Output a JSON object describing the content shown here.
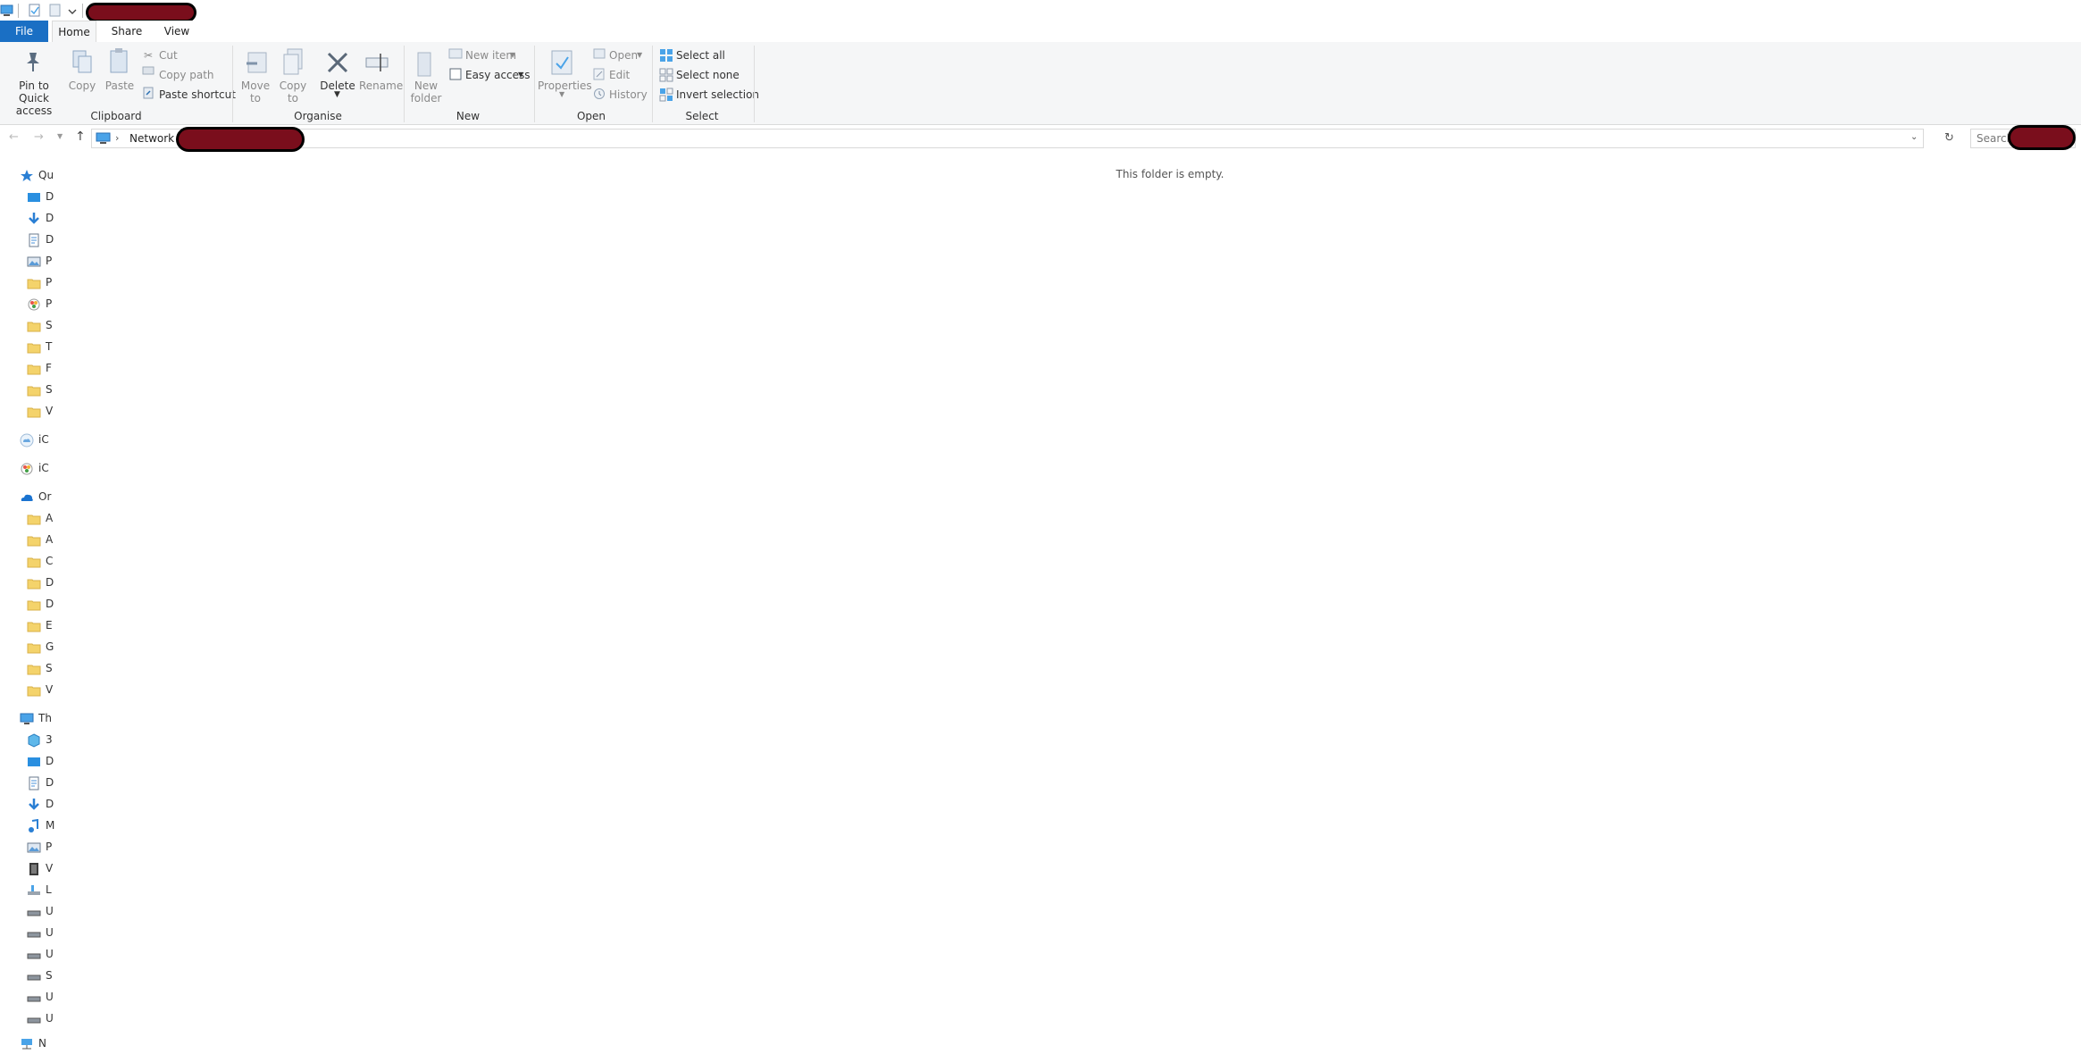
{
  "tabs": {
    "file": "File",
    "home": "Home",
    "share": "Share",
    "view": "View"
  },
  "ribbon": {
    "clipboard": {
      "pin": "Pin to Quick access",
      "copy": "Copy",
      "paste": "Paste",
      "cut": "Cut",
      "copy_path": "Copy path",
      "paste_shortcut": "Paste shortcut",
      "group": "Clipboard"
    },
    "organise": {
      "move_to": "Move to",
      "copy_to": "Copy to",
      "delete": "Delete",
      "rename": "Rename",
      "group": "Organise"
    },
    "new": {
      "new_folder": "New folder",
      "new_item": "New item",
      "easy_access": "Easy access",
      "group": "New"
    },
    "open": {
      "properties": "Properties",
      "open": "Open",
      "edit": "Edit",
      "history": "History",
      "group": "Open"
    },
    "select": {
      "select_all": "Select all",
      "select_none": "Select none",
      "invert_selection": "Invert selection",
      "group": "Select"
    }
  },
  "address": {
    "root": "Network",
    "search_placeholder": "Search"
  },
  "nav": {
    "items": [
      {
        "label": "Qu",
        "icon": "star-icon"
      },
      {
        "label": "D",
        "icon": "desktop-icon"
      },
      {
        "label": "D",
        "icon": "download-icon"
      },
      {
        "label": "D",
        "icon": "document-icon"
      },
      {
        "label": "P",
        "icon": "pictures-icon"
      },
      {
        "label": "P",
        "icon": "folder-icon"
      },
      {
        "label": "P",
        "icon": "photos-icon"
      },
      {
        "label": "S",
        "icon": "folder-icon"
      },
      {
        "label": "T",
        "icon": "folder-icon"
      },
      {
        "label": "F",
        "icon": "folder-icon"
      },
      {
        "label": "S",
        "icon": "folder-icon"
      },
      {
        "label": "V",
        "icon": "folder-icon"
      },
      {
        "label": "iC",
        "icon": "icloud-icon"
      },
      {
        "label": "iC",
        "icon": "photos-icon"
      },
      {
        "label": "Or",
        "icon": "onedrive-icon"
      },
      {
        "label": "A",
        "icon": "folder-icon"
      },
      {
        "label": "A",
        "icon": "folder-icon"
      },
      {
        "label": "C",
        "icon": "folder-icon"
      },
      {
        "label": "D",
        "icon": "folder-icon"
      },
      {
        "label": "D",
        "icon": "folder-icon"
      },
      {
        "label": "E",
        "icon": "folder-icon"
      },
      {
        "label": "G",
        "icon": "folder-icon"
      },
      {
        "label": "S",
        "icon": "folder-icon"
      },
      {
        "label": "V",
        "icon": "folder-icon"
      },
      {
        "label": "Th",
        "icon": "this-pc-icon"
      },
      {
        "label": "3",
        "icon": "3d-objects-icon"
      },
      {
        "label": "D",
        "icon": "desktop-icon"
      },
      {
        "label": "D",
        "icon": "document-icon"
      },
      {
        "label": "D",
        "icon": "download-icon"
      },
      {
        "label": "M",
        "icon": "music-icon"
      },
      {
        "label": "P",
        "icon": "pictures-icon"
      },
      {
        "label": "V",
        "icon": "videos-icon"
      },
      {
        "label": "L",
        "icon": "local-disk-icon"
      },
      {
        "label": "U",
        "icon": "drive-icon"
      },
      {
        "label": "U",
        "icon": "drive-icon"
      },
      {
        "label": "U",
        "icon": "drive-icon"
      },
      {
        "label": "S",
        "icon": "drive-icon"
      },
      {
        "label": "U",
        "icon": "drive-icon"
      },
      {
        "label": "U",
        "icon": "drive-icon"
      },
      {
        "label": "N",
        "icon": "network-icon"
      }
    ]
  },
  "content": {
    "empty_message": "This folder is empty."
  },
  "colors": {
    "accent": "#1a6fc4",
    "redaction": "#7a0e1c",
    "folder": "#f4d36b"
  }
}
